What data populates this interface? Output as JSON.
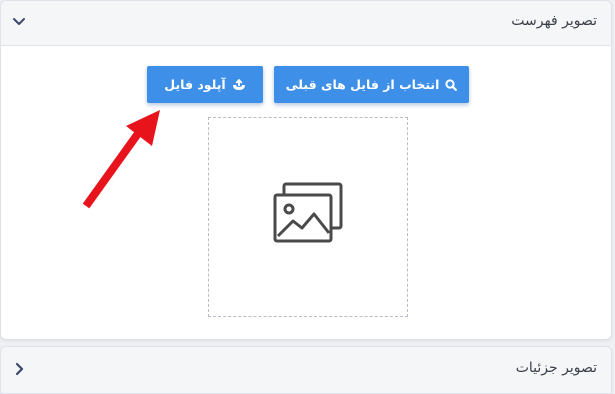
{
  "featured_panel": {
    "title": "تصویر فهرست",
    "toggle_icon": "chevron-down-icon",
    "buttons": {
      "select_label": "انتخاب از فایل های قبلی",
      "select_icon": "search-icon",
      "upload_label": "آپلود فایل",
      "upload_icon": "upload-icon"
    },
    "placeholder_icon": "image-gallery-icon"
  },
  "details_panel": {
    "title": "تصویر جزئیات",
    "toggle_icon": "chevron-left-icon"
  },
  "annotation": {
    "arrow_icon": "red-arrow-icon",
    "arrow_color": "#e8141c"
  },
  "colors": {
    "button_blue": "#3d8fe8",
    "header_bg": "#f5f6f8",
    "page_bg": "#eef0f4"
  }
}
